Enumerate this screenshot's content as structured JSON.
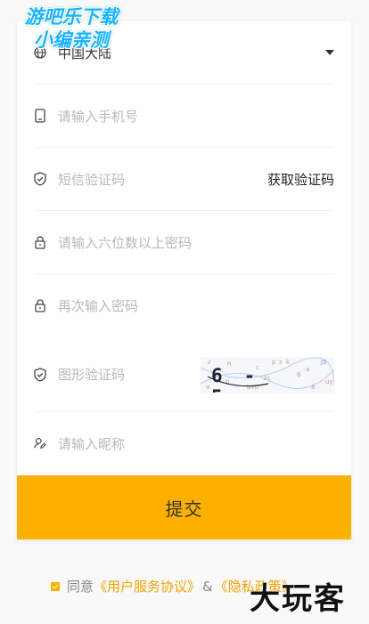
{
  "form": {
    "region": {
      "value": "中国大陆"
    },
    "phone": {
      "placeholder": "请输入手机号"
    },
    "sms": {
      "placeholder": "短信验证码",
      "get_code_label": "获取验证码"
    },
    "password": {
      "placeholder": "请输入六位数以上密码"
    },
    "password_confirm": {
      "placeholder": "再次输入密码"
    },
    "captcha": {
      "placeholder": "图形验证码",
      "code_text": "6-5="
    },
    "nickname": {
      "placeholder": "请输入昵称"
    },
    "submit_label": "提交"
  },
  "agreement": {
    "prefix": "同意",
    "user_agreement": "《用户服务协议》",
    "amp": "&",
    "privacy_policy": "《隐私政策》"
  },
  "watermarks": {
    "top_line1": "游吧乐下载",
    "top_line2": "小编亲测",
    "bottom": "大玩客"
  },
  "colors": {
    "accent": "#fdb000",
    "link": "#f6a100"
  }
}
